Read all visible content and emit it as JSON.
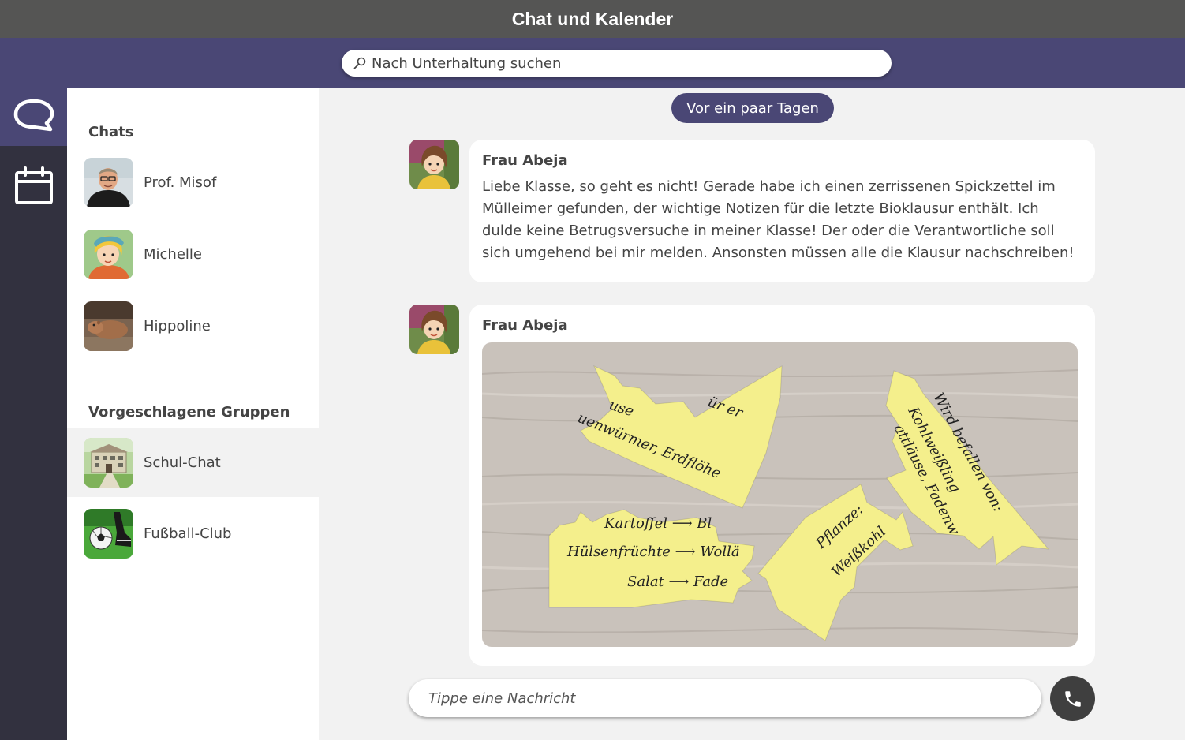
{
  "app": {
    "title": "Chat und Kalender"
  },
  "search": {
    "placeholder": "Nach Unterhaltung suchen"
  },
  "rail": {
    "items": [
      {
        "icon": "chat-bubble-icon",
        "active": true
      },
      {
        "icon": "calendar-icon",
        "active": false
      }
    ]
  },
  "sidebar": {
    "chats_heading": "Chats",
    "chats": [
      {
        "name": "Prof. Misof"
      },
      {
        "name": "Michelle"
      },
      {
        "name": "Hippoline"
      }
    ],
    "groups_heading": "Vorgeschlagene Gruppen",
    "groups": [
      {
        "name": "Schul-Chat",
        "selected": true
      },
      {
        "name": "Fußball-Club",
        "selected": false
      }
    ]
  },
  "conversation": {
    "date_separator": "Vor ein paar Tagen",
    "messages": [
      {
        "sender": "Frau Abeja",
        "text": "Liebe Klasse, so geht es nicht! Gerade habe ich einen zerrissenen Spickzettel im Mülleimer gefunden, der wichtige Notizen für die letzte Bioklausur enthält. Ich dulde keine Betrugsversuche in meiner Klasse! Der oder die Verantwortliche soll sich umgehend bei mir melden. Ansonsten müssen alle die Klausur nachschreiben!"
      },
      {
        "sender": "Frau Abeja",
        "image": {
          "note_a": [
            "use",
            "ür  er",
            "uenwürmer, Erdflöhe"
          ],
          "note_b": [
            "Kartoffel ⟶ Bl",
            "Hülsenfrüchte ⟶ Wollä",
            "Salat ⟶ Fade"
          ],
          "note_c": [
            "Pflanze:",
            "Weißkohl"
          ],
          "note_d": [
            "Wird befallen von:",
            "Kohlweißling",
            "attläuse, Fadenw"
          ]
        }
      }
    ]
  },
  "composer": {
    "placeholder": "Tippe eine Nachricht"
  },
  "colors": {
    "title_bar": "#555554",
    "accent": "#4a4775",
    "rail": "#32313f",
    "note": "#f4ef8c"
  }
}
